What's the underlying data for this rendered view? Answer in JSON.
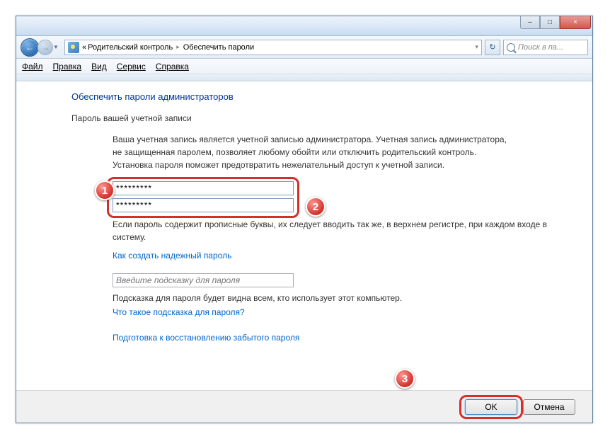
{
  "window": {
    "min_icon": "–",
    "max_icon": "□",
    "close_icon": "×"
  },
  "nav": {
    "back_icon": "←",
    "fwd_icon": "→",
    "drop_icon": "▼",
    "refresh_icon": "↻"
  },
  "breadcrumb": {
    "prefix": "«",
    "item1": "Родительский контроль",
    "sep": "▸",
    "item2": "Обеспечить пароли",
    "chev": "▾"
  },
  "search": {
    "placeholder": "Поиск в па..."
  },
  "menu": {
    "file": "Файл",
    "edit": "Правка",
    "view": "Вид",
    "service": "Сервис",
    "help": "Справка"
  },
  "page": {
    "title": "Обеспечить пароли администраторов",
    "section_label": "Пароль вашей учетной записи",
    "description": "Ваша учетная запись является учетной записью администратора. Учетная запись администратора, не защищенная паролем, позволяет любому обойти или отключить родительский контроль. Установка пароля поможет предотвратить нежелательный доступ к учетной записи.",
    "pw1_value": "*********",
    "pw2_value": "*********",
    "caps_note": "Если пароль содержит прописные буквы, их следует вводить так же, в верхнем регистре, при каждом входе в систему.",
    "link_strong_pw": "Как создать надежный пароль",
    "hint_placeholder": "Введите подсказку для пароля",
    "hint_note": "Подсказка для пароля будет видна всем, кто использует этот компьютер.",
    "link_what_hint": "Что такое подсказка для пароля?",
    "link_recovery": "Подготовка к восстановлению забытого пароля"
  },
  "footer": {
    "ok": "OK",
    "cancel": "Отмена"
  },
  "badges": {
    "b1": "1",
    "b2": "2",
    "b3": "3"
  }
}
